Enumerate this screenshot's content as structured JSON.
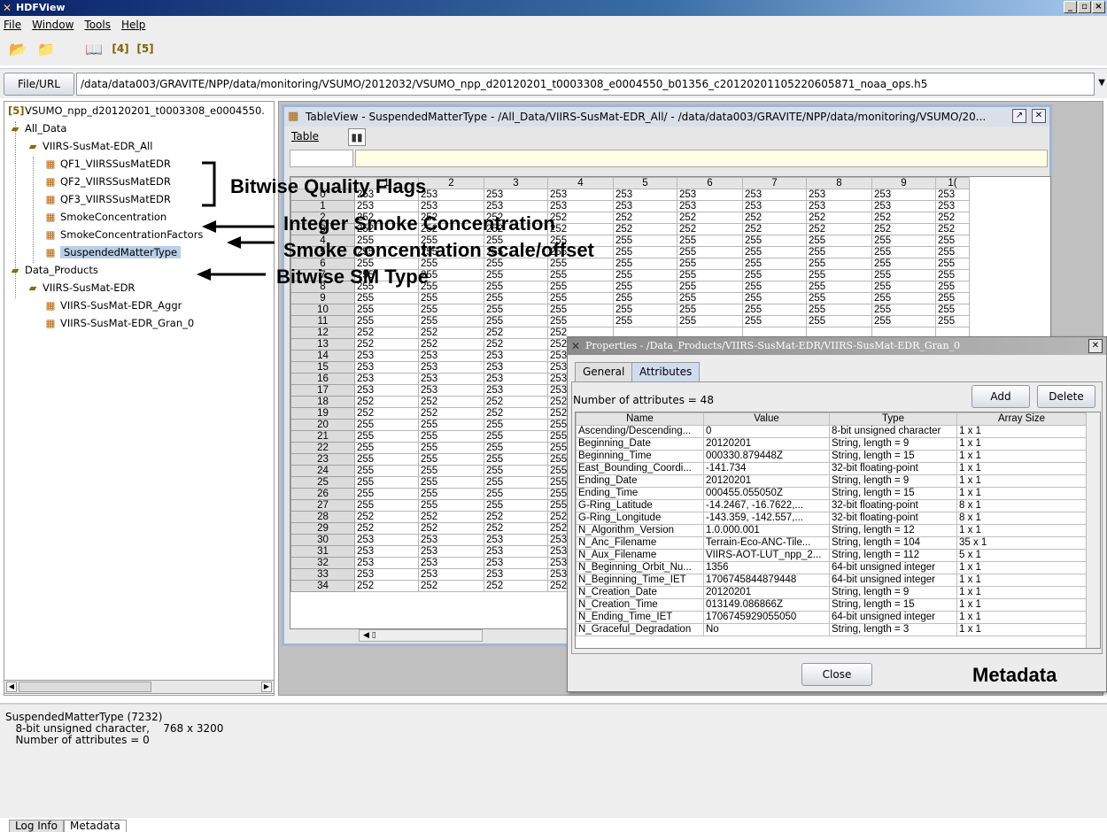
{
  "window": {
    "title": "HDFView",
    "controls": [
      "_",
      "×"
    ]
  },
  "menu": {
    "items": [
      "File",
      "Window",
      "Tools",
      "Help"
    ]
  },
  "toolbar": {
    "icons": [
      "open-file-icon",
      "close-file-icon",
      "help-book-icon",
      "hdf4-library-icon",
      "hdf5-library-icon"
    ]
  },
  "url": {
    "button_label": "File/URL",
    "value": "/data/data003/GRAVITE/NPP/data/monitoring/VSUMO/2012032/VSUMO_npp_d20120201_t0003308_e0004550_b01356_c20120201105220605871_noaa_ops.h5"
  },
  "tree": {
    "root": "VSUMO_npp_d20120201_t0003308_e0004550.",
    "all_data": "All_Data",
    "group_all": "VIIRS-SusMat-EDR_All",
    "qf1": "QF1_VIIRSSusMatEDR",
    "qf2": "QF2_VIIRSSusMatEDR",
    "qf3": "QF3_VIIRSSusMatEDR",
    "smoke": "SmokeConcentration",
    "smoke_factors": "SmokeConcentrationFactors",
    "suspended": "SuspendedMatterType",
    "data_products": "Data_Products",
    "group_edr": "VIIRS-SusMat-EDR",
    "aggr": "VIIRS-SusMat-EDR_Aggr",
    "gran": "VIIRS-SusMat-EDR_Gran_0"
  },
  "annotations": {
    "quality": "Bitwise Quality Flags",
    "smoke_int": "Integer Smoke Concentration",
    "smoke_scale": "Smoke concentration scale/offset",
    "sm_type": "Bitwise SM Type",
    "metadata": "Metadata"
  },
  "tableview": {
    "title": "TableView  -  SuspendedMatterType  -  /All_Data/VIIRS-SusMat-EDR_All/  -  /data/data003/GRAVITE/NPP/data/monitoring/VSUMO/20...",
    "menu": "Table",
    "columns": [
      "",
      "1",
      "2",
      "3",
      "4",
      "5",
      "6",
      "7",
      "8",
      "9",
      "1("
    ],
    "rows": [
      [
        "0",
        "253",
        "253",
        "253",
        "253",
        "253",
        "253",
        "253",
        "253",
        "253",
        "253"
      ],
      [
        "1",
        "253",
        "253",
        "253",
        "253",
        "253",
        "253",
        "253",
        "253",
        "253",
        "253"
      ],
      [
        "2",
        "252",
        "252",
        "252",
        "252",
        "252",
        "252",
        "252",
        "252",
        "252",
        "252"
      ],
      [
        "3",
        "252",
        "252",
        "252",
        "252",
        "252",
        "252",
        "252",
        "252",
        "252",
        "252"
      ],
      [
        "4",
        "255",
        "255",
        "255",
        "255",
        "255",
        "255",
        "255",
        "255",
        "255",
        "255"
      ],
      [
        "5",
        "255",
        "255",
        "255",
        "255",
        "255",
        "255",
        "255",
        "255",
        "255",
        "255"
      ],
      [
        "6",
        "255",
        "255",
        "255",
        "255",
        "255",
        "255",
        "255",
        "255",
        "255",
        "255"
      ],
      [
        "7",
        "255",
        "255",
        "255",
        "255",
        "255",
        "255",
        "255",
        "255",
        "255",
        "255"
      ],
      [
        "8",
        "255",
        "255",
        "255",
        "255",
        "255",
        "255",
        "255",
        "255",
        "255",
        "255"
      ],
      [
        "9",
        "255",
        "255",
        "255",
        "255",
        "255",
        "255",
        "255",
        "255",
        "255",
        "255"
      ],
      [
        "10",
        "255",
        "255",
        "255",
        "255",
        "255",
        "255",
        "255",
        "255",
        "255",
        "255"
      ],
      [
        "11",
        "255",
        "255",
        "255",
        "255",
        "255",
        "255",
        "255",
        "255",
        "255",
        "255"
      ],
      [
        "12",
        "252",
        "252",
        "252",
        "252",
        "",
        "",
        "",
        "",
        "",
        ""
      ],
      [
        "13",
        "252",
        "252",
        "252",
        "252",
        "",
        "",
        "",
        "",
        "",
        ""
      ],
      [
        "14",
        "253",
        "253",
        "253",
        "253",
        "",
        "",
        "",
        "",
        "",
        ""
      ],
      [
        "15",
        "253",
        "253",
        "253",
        "253",
        "",
        "",
        "",
        "",
        "",
        ""
      ],
      [
        "16",
        "253",
        "253",
        "253",
        "253",
        "",
        "",
        "",
        "",
        "",
        ""
      ],
      [
        "17",
        "253",
        "253",
        "253",
        "253",
        "",
        "",
        "",
        "",
        "",
        ""
      ],
      [
        "18",
        "252",
        "252",
        "252",
        "252",
        "",
        "",
        "",
        "",
        "",
        ""
      ],
      [
        "19",
        "252",
        "252",
        "252",
        "252",
        "",
        "",
        "",
        "",
        "",
        ""
      ],
      [
        "20",
        "255",
        "255",
        "255",
        "255",
        "",
        "",
        "",
        "",
        "",
        ""
      ],
      [
        "21",
        "255",
        "255",
        "255",
        "255",
        "",
        "",
        "",
        "",
        "",
        ""
      ],
      [
        "22",
        "255",
        "255",
        "255",
        "255",
        "",
        "",
        "",
        "",
        "",
        ""
      ],
      [
        "23",
        "255",
        "255",
        "255",
        "255",
        "",
        "",
        "",
        "",
        "",
        ""
      ],
      [
        "24",
        "255",
        "255",
        "255",
        "255",
        "",
        "",
        "",
        "",
        "",
        ""
      ],
      [
        "25",
        "255",
        "255",
        "255",
        "255",
        "",
        "",
        "",
        "",
        "",
        ""
      ],
      [
        "26",
        "255",
        "255",
        "255",
        "255",
        "",
        "",
        "",
        "",
        "",
        ""
      ],
      [
        "27",
        "255",
        "255",
        "255",
        "255",
        "",
        "",
        "",
        "",
        "",
        ""
      ],
      [
        "28",
        "252",
        "252",
        "252",
        "252",
        "",
        "",
        "",
        "",
        "",
        ""
      ],
      [
        "29",
        "252",
        "252",
        "252",
        "252",
        "",
        "",
        "",
        "",
        "",
        ""
      ],
      [
        "30",
        "253",
        "253",
        "253",
        "253",
        "",
        "",
        "",
        "",
        "",
        ""
      ],
      [
        "31",
        "253",
        "253",
        "253",
        "253",
        "",
        "",
        "",
        "",
        "",
        ""
      ],
      [
        "32",
        "253",
        "253",
        "253",
        "253",
        "",
        "",
        "",
        "",
        "",
        ""
      ],
      [
        "33",
        "253",
        "253",
        "253",
        "253",
        "",
        "",
        "",
        "",
        "",
        ""
      ],
      [
        "34",
        "252",
        "252",
        "252",
        "252",
        "",
        "",
        "",
        "",
        "",
        ""
      ]
    ]
  },
  "properties": {
    "title": "Properties - /Data_Products/VIIRS-SusMat-EDR/VIIRS-SusMat-EDR_Gran_0",
    "tabs": [
      "General",
      "Attributes"
    ],
    "attr_count": "Number of attributes = 48",
    "add_label": "Add",
    "delete_label": "Delete",
    "close_label": "Close",
    "columns": [
      "Name",
      "Value",
      "Type",
      "Array Size"
    ],
    "rows": [
      [
        "Ascending/Descending...",
        "0",
        "8-bit unsigned character",
        "1 x 1"
      ],
      [
        "Beginning_Date",
        "20120201",
        "String, length = 9",
        "1 x 1"
      ],
      [
        "Beginning_Time",
        "000330.879448Z",
        "String, length = 15",
        "1 x 1"
      ],
      [
        "East_Bounding_Coordi...",
        "-141.734",
        "32-bit floating-point",
        "1 x 1"
      ],
      [
        "Ending_Date",
        "20120201",
        "String, length = 9",
        "1 x 1"
      ],
      [
        "Ending_Time",
        "000455.055050Z",
        "String, length = 15",
        "1 x 1"
      ],
      [
        "G-Ring_Latitude",
        "-14.2467, -16.7622,...",
        "32-bit floating-point",
        "8 x 1"
      ],
      [
        "G-Ring_Longitude",
        "-143.359, -142.557,...",
        "32-bit floating-point",
        "8 x 1"
      ],
      [
        "N_Algorithm_Version",
        "1.0.000.001",
        "String, length = 12",
        "1 x 1"
      ],
      [
        "N_Anc_Filename",
        "Terrain-Eco-ANC-Tile...",
        "String, length = 104",
        "35 x 1"
      ],
      [
        "N_Aux_Filename",
        "VIIRS-AOT-LUT_npp_2...",
        "String, length = 112",
        "5 x 1"
      ],
      [
        "N_Beginning_Orbit_Nu...",
        "1356",
        "64-bit unsigned integer",
        "1 x 1"
      ],
      [
        "N_Beginning_Time_IET",
        "1706745844879448",
        "64-bit unsigned integer",
        "1 x 1"
      ],
      [
        "N_Creation_Date",
        "20120201",
        "String, length = 9",
        "1 x 1"
      ],
      [
        "N_Creation_Time",
        "013149.086866Z",
        "String, length = 15",
        "1 x 1"
      ],
      [
        "N_Ending_Time_IET",
        "1706745929055050",
        "64-bit unsigned integer",
        "1 x 1"
      ],
      [
        "N_Graceful_Degradation",
        "No",
        "String, length = 3",
        "1 x 1"
      ]
    ]
  },
  "status": {
    "line1": "SuspendedMatterType (7232)",
    "line2": "   8-bit unsigned character,    768 x 3200",
    "line3": "   Number of attributes = 0",
    "tabs": [
      "Log Info",
      "Metadata"
    ]
  }
}
